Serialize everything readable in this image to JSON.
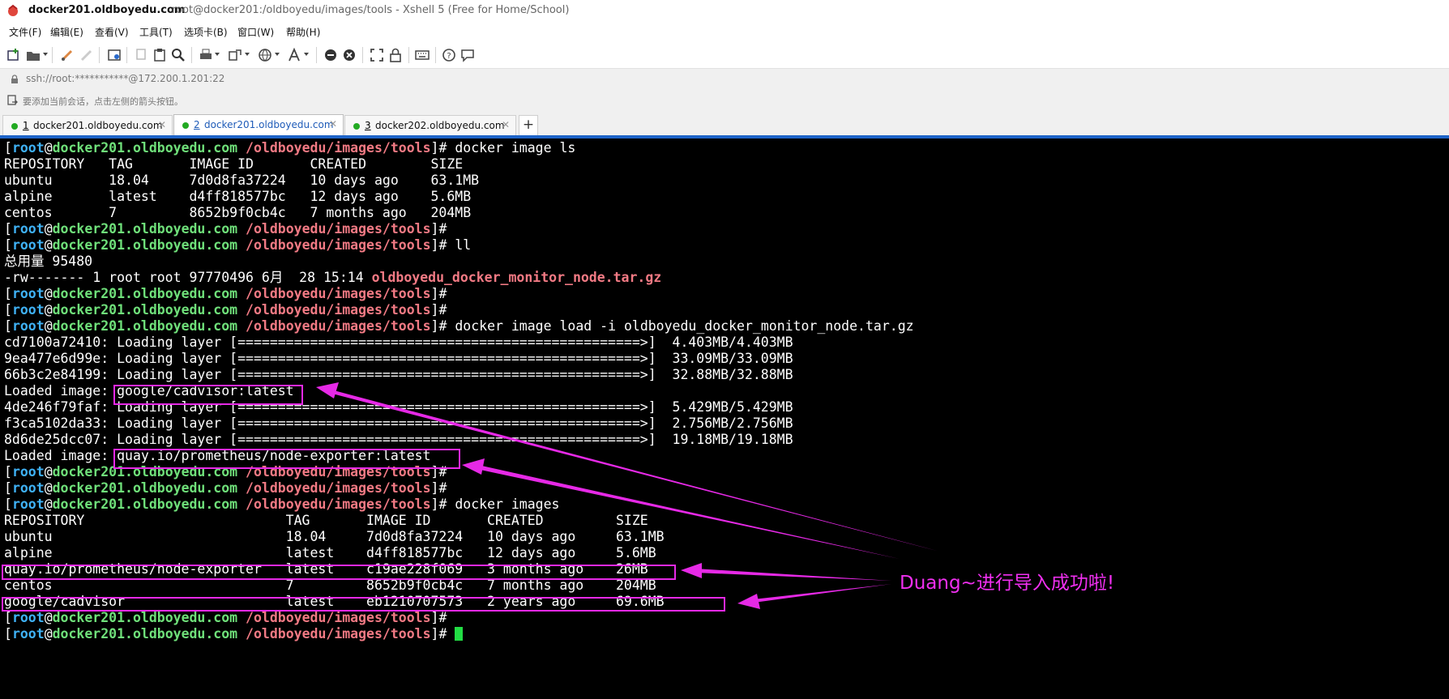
{
  "window": {
    "title_host": "docker201.oldboyedu.com",
    "title_rest": "root@docker201:/oldboyedu/images/tools - Xshell 5 (Free for Home/School)"
  },
  "menu": [
    "文件(F)",
    "编辑(E)",
    "查看(V)",
    "工具(T)",
    "选项卡(B)",
    "窗口(W)",
    "帮助(H)"
  ],
  "toolbar_icons": [
    "new-session-icon",
    "open-folder-icon",
    "disconnect-icon",
    "reconnect-icon",
    "properties-icon",
    "copy-icon",
    "paste-icon",
    "find-icon",
    "print-icon",
    "transfer-icon",
    "globe-icon",
    "font-icon",
    "xftp-icon",
    "xmanager-icon",
    "fullscreen-icon",
    "lock-icon",
    "keyboard-icon",
    "help-icon",
    "chat-icon"
  ],
  "address": {
    "text": "ssh://root:***********@172.200.1.201:22"
  },
  "hint": {
    "text": "要添加当前会话，点击左侧的箭头按钮。"
  },
  "tabs": [
    {
      "num": "1",
      "label": "docker201.oldboyedu.com",
      "active": false
    },
    {
      "num": "2",
      "label": "docker201.oldboyedu.com",
      "active": true
    },
    {
      "num": "3",
      "label": "docker202.oldboyedu.com",
      "active": false
    }
  ],
  "tab_add": "+",
  "prompt": {
    "open": "[",
    "user": "root",
    "at": "@",
    "host": "docker201.oldboyedu.com",
    "path": " /oldboyedu/images/tools",
    "close": "]#"
  },
  "terminal_lines": [
    {
      "cmd": " docker image ls"
    },
    {
      "text": "REPOSITORY   TAG       IMAGE ID       CREATED        SIZE"
    },
    {
      "text": "ubuntu       18.04     7d0d8fa37224   10 days ago    63.1MB"
    },
    {
      "text": "alpine       latest    d4ff818577bc   12 days ago    5.6MB"
    },
    {
      "text": "centos       7         8652b9f0cb4c   7 months ago   204MB"
    },
    {
      "cmd": ""
    },
    {
      "cmd": " ll"
    },
    {
      "text": "总用量 95480"
    },
    {
      "text": "-rw------- 1 root root 97770496 6月  28 15:14 ",
      "file": "oldboyedu_docker_monitor_node.tar.gz"
    },
    {
      "cmd": ""
    },
    {
      "cmd": ""
    },
    {
      "cmd": " docker image load -i oldboyedu_docker_monitor_node.tar.gz"
    },
    {
      "text": "cd7100a72410: Loading layer [==================================================>]  4.403MB/4.403MB"
    },
    {
      "text": "9ea477e6d99e: Loading layer [==================================================>]  33.09MB/33.09MB"
    },
    {
      "text": "66b3c2e84199: Loading layer [==================================================>]  32.88MB/32.88MB"
    },
    {
      "text": "Loaded image: google/cadvisor:latest"
    },
    {
      "text": "4de246f79faf: Loading layer [==================================================>]  5.429MB/5.429MB"
    },
    {
      "text": "f3ca5102da33: Loading layer [==================================================>]  2.756MB/2.756MB"
    },
    {
      "text": "8d6de25dcc07: Loading layer [==================================================>]  19.18MB/19.18MB"
    },
    {
      "text": "Loaded image: quay.io/prometheus/node-exporter:latest"
    },
    {
      "cmd": ""
    },
    {
      "cmd": ""
    },
    {
      "cmd": " docker images"
    },
    {
      "text": "REPOSITORY                         TAG       IMAGE ID       CREATED         SIZE"
    },
    {
      "text": "ubuntu                             18.04     7d0d8fa37224   10 days ago     63.1MB"
    },
    {
      "text": "alpine                             latest    d4ff818577bc   12 days ago     5.6MB"
    },
    {
      "text": "quay.io/prometheus/node-exporter   latest    c19ae228f069   3 months ago    26MB"
    },
    {
      "text": "centos                             7         8652b9f0cb4c   7 months ago    204MB"
    },
    {
      "text": "google/cadvisor                    latest    eb1210707573   2 years ago     69.6MB"
    },
    {
      "cmd": ""
    },
    {
      "cmd": " ",
      "cursor": true
    }
  ],
  "annotation": "Duang~进行导入成功啦!",
  "colors": {
    "tab_accent": "#1e64c8",
    "prompt_user": "#3fb1f5",
    "prompt_host": "#6fe07a",
    "prompt_path": "#f27a84",
    "highlight": "#e629e6",
    "cursor": "#22dd44"
  }
}
